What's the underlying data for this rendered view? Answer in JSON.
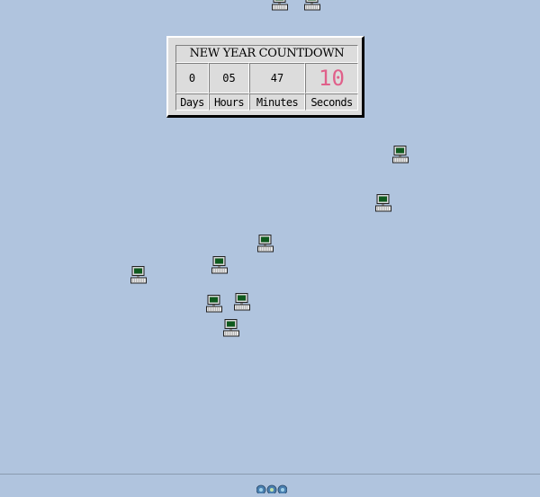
{
  "countdown": {
    "title": "NEW YEAR COUNTDOWN",
    "days": "0",
    "hours": "05",
    "minutes": "47",
    "seconds": "10",
    "days_label": "Days",
    "hours_label": "Hours",
    "minutes_label": "Minutes",
    "seconds_label": "Seconds",
    "seconds_color": "#e0608a"
  },
  "desktop": {
    "background_color": "#b0c4de",
    "icon_name": "computer-icon"
  },
  "taskbar": {
    "tray_icon_name": "network-globe-icon"
  }
}
